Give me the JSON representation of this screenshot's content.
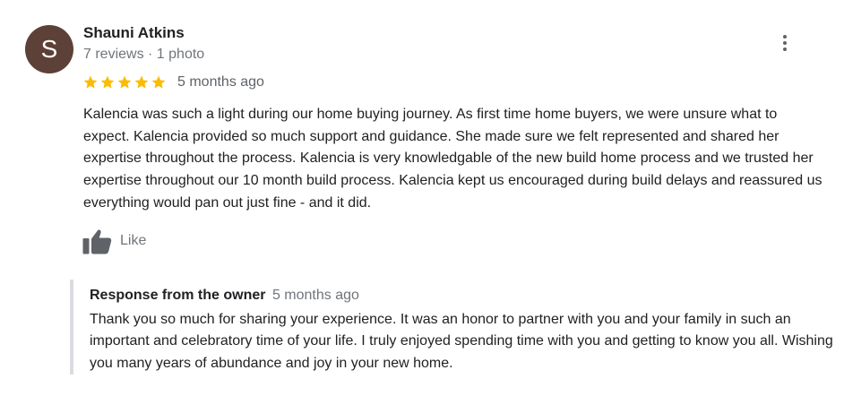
{
  "review": {
    "avatar_initial": "S",
    "avatar_color": "#5d4037",
    "reviewer_name": "Shauni Atkins",
    "reviewer_meta": "7 reviews · 1 photo",
    "rating": 5,
    "rating_max": 5,
    "star_color": "#fbbc04",
    "date": "5 months ago",
    "text": "Kalencia was such a light during our home buying journey. As first time home buyers, we were unsure what to expect. Kalencia provided so much support and guidance. She made sure we felt represented and shared her expertise throughout the process. Kalencia is very knowledgable of the new build home process and we trusted her expertise throughout our 10 month build process. Kalencia kept us encouraged during build delays and reassured us everything would pan out just fine - and it did.",
    "like_label": "Like",
    "more_icon": "more-vert-icon",
    "like_icon": "thumbs-up-icon"
  },
  "owner_response": {
    "title": "Response from the owner",
    "date": "5 months ago",
    "text": "Thank you so much for sharing your experience. It was an honor to partner with you and your family in such an important and celebratory time of your life. I truly enjoyed spending time with you and getting to know you all. Wishing you many years of abundance and joy in your new home."
  }
}
